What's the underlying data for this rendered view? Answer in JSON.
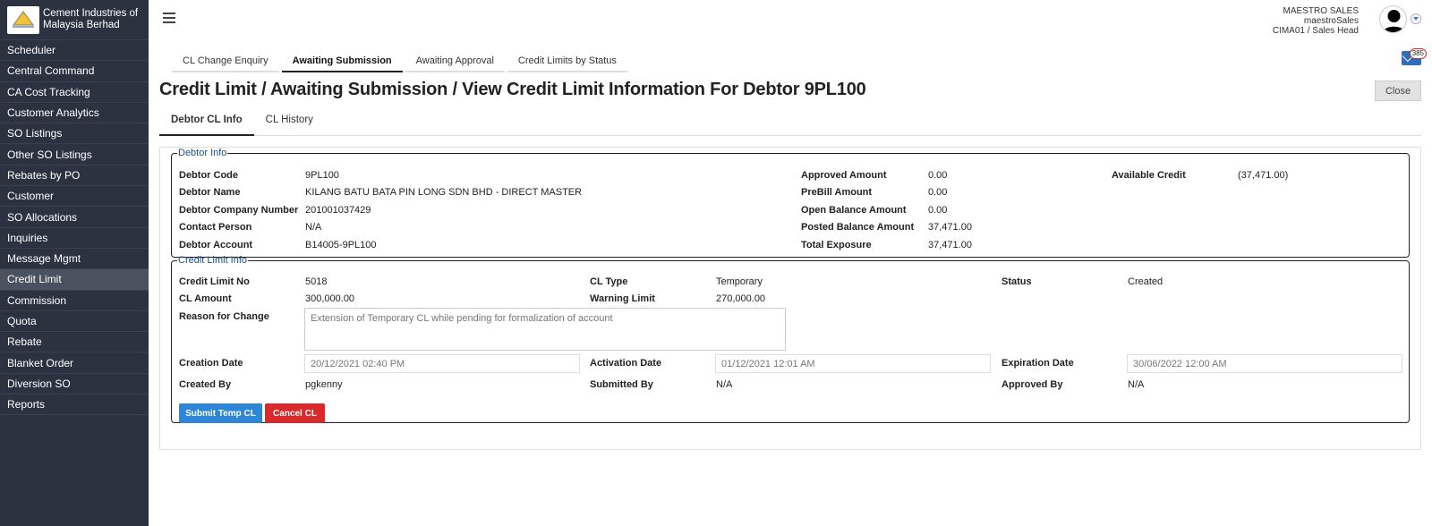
{
  "brand": {
    "line1": "Cement Industries of",
    "line2": "Malaysia Berhad"
  },
  "sidebar": {
    "items": [
      {
        "label": "Scheduler"
      },
      {
        "label": "Central Command"
      },
      {
        "label": "CA Cost Tracking"
      },
      {
        "label": "Customer Analytics"
      },
      {
        "label": "SO Listings"
      },
      {
        "label": "Other SO Listings"
      },
      {
        "label": "Rebates by PO"
      },
      {
        "label": "Customer"
      },
      {
        "label": "SO Allocations"
      },
      {
        "label": "Inquiries"
      },
      {
        "label": "Message Mgmt"
      },
      {
        "label": "Credit Limit"
      },
      {
        "label": "Commission"
      },
      {
        "label": "Quota"
      },
      {
        "label": "Rebate"
      },
      {
        "label": "Blanket Order"
      },
      {
        "label": "Diversion SO"
      },
      {
        "label": "Reports"
      }
    ],
    "active_index": 11
  },
  "user": {
    "line1": "MAESTRO SALES",
    "line2": "maestroSales",
    "line3": "CIMA01 / Sales Head"
  },
  "mail_count": "385",
  "top_tabs": [
    {
      "label": "CL Change Enquiry"
    },
    {
      "label": "Awaiting Submission"
    },
    {
      "label": "Awaiting Approval"
    },
    {
      "label": "Credit Limits by Status"
    }
  ],
  "page_title": "Credit Limit / Awaiting Submission / View Credit Limit Information For Debtor 9PL100",
  "close_label": "Close",
  "sub_tabs": [
    {
      "label": "Debtor CL Info"
    },
    {
      "label": "CL History"
    }
  ],
  "debtor_info": {
    "legend": "Debtor Info",
    "debtor_code_label": "Debtor Code",
    "debtor_code": "9PL100",
    "debtor_name_label": "Debtor Name",
    "debtor_name": "KILANG BATU BATA PIN LONG SDN BHD - DIRECT MASTER",
    "company_number_label": "Debtor Company Number",
    "company_number": "201001037429",
    "contact_person_label": "Contact Person",
    "contact_person": "N/A",
    "debtor_account_label": "Debtor Account",
    "debtor_account": "B14005-9PL100",
    "approved_amount_label": "Approved Amount",
    "approved_amount": "0.00",
    "prebill_amount_label": "PreBill Amount",
    "prebill_amount": "0.00",
    "open_balance_label": "Open Balance Amount",
    "open_balance": "0.00",
    "posted_balance_label": "Posted Balance Amount",
    "posted_balance": "37,471.00",
    "total_exposure_label": "Total Exposure",
    "total_exposure": "37,471.00",
    "available_credit_label": "Available Credit",
    "available_credit": "(37,471.00)"
  },
  "credit_info": {
    "legend": "Credit Limit Info",
    "cl_no_label": "Credit Limit No",
    "cl_no": "5018",
    "cl_type_label": "CL Type",
    "cl_type": "Temporary",
    "status_label": "Status",
    "status": "Created",
    "cl_amount_label": "CL Amount",
    "cl_amount": "300,000.00",
    "warning_limit_label": "Warning Limit",
    "warning_limit": "270,000.00",
    "reason_label": "Reason for Change",
    "reason": "Extension of Temporary CL while pending for formalization of account",
    "creation_date_label": "Creation Date",
    "creation_date": "20/12/2021 02:40 PM",
    "activation_date_label": "Activation Date",
    "activation_date": "01/12/2021 12:01 AM",
    "expiration_date_label": "Expiration Date",
    "expiration_date": "30/06/2022 12:00 AM",
    "created_by_label": "Created By",
    "created_by": "pgkenny",
    "submitted_by_label": "Submitted By",
    "submitted_by": "N/A",
    "approved_by_label": "Approved By",
    "approved_by": "N/A"
  },
  "actions": {
    "submit_label": "Submit Temp CL",
    "cancel_label": "Cancel CL"
  }
}
